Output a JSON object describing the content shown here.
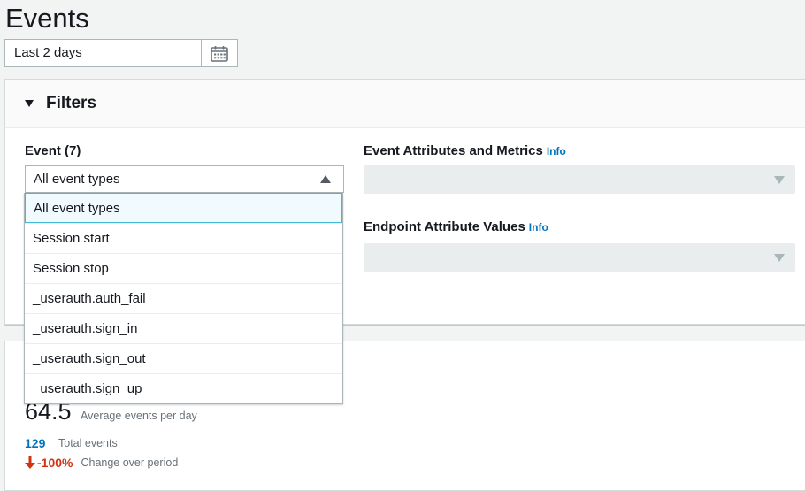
{
  "page": {
    "title": "Events"
  },
  "date_range": {
    "value": "Last 2 days",
    "icon": "calendar-icon"
  },
  "filters": {
    "title": "Filters",
    "event": {
      "label": "Event (7)",
      "selected": "All event types",
      "options": [
        "All event types",
        "Session start",
        "Session stop",
        "_userauth.auth_fail",
        "_userauth.sign_in",
        "_userauth.sign_out",
        "_userauth.sign_up"
      ]
    },
    "event_attributes": {
      "label": "Event Attributes and Metrics",
      "info": "Info"
    },
    "endpoint_attributes": {
      "label": "Endpoint Attribute Values",
      "info": "Info"
    }
  },
  "metrics": {
    "average": {
      "value": "64.5",
      "caption": "Average events per day"
    },
    "total": {
      "value": "129",
      "caption": "Total events"
    },
    "change": {
      "value": "-100%",
      "caption": "Change over period"
    }
  },
  "colors": {
    "link": "#0073bb",
    "negative": "#d13212",
    "focus_border": "#44b9d6"
  }
}
